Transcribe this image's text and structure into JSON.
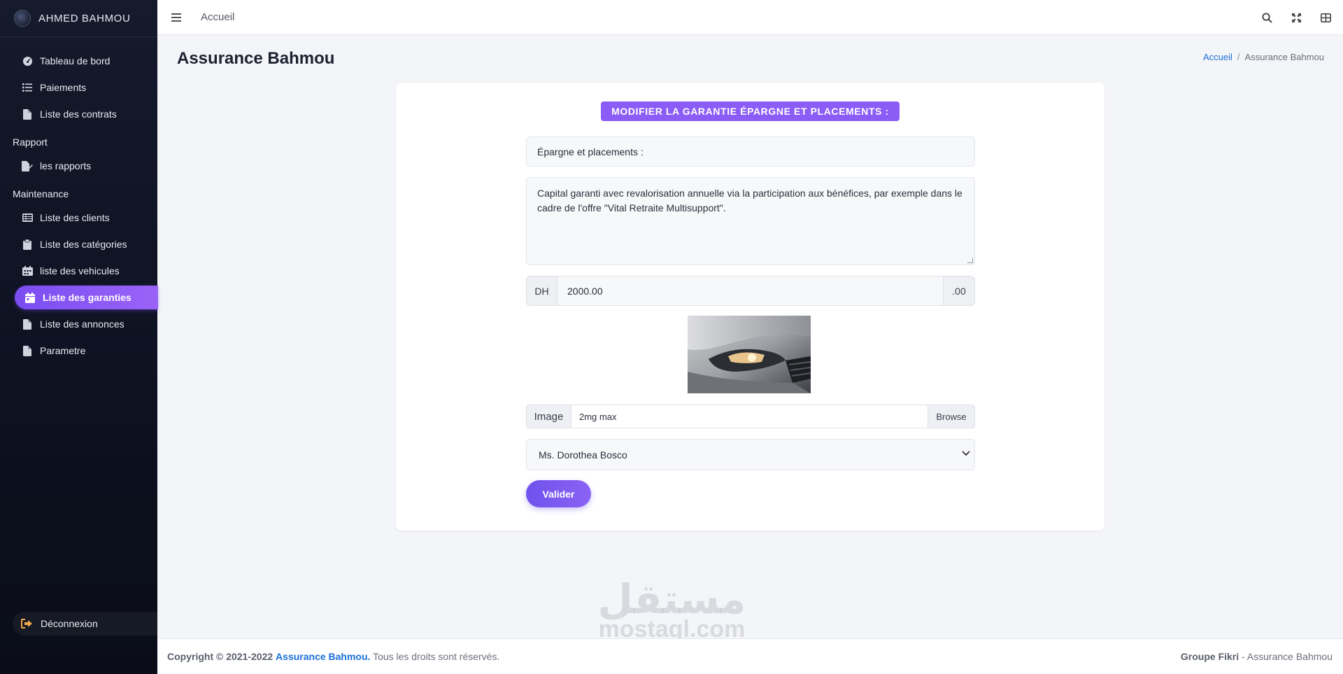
{
  "sidebar": {
    "brand": "AHMED BAHMOU",
    "items": [
      {
        "label": "Tableau de bord"
      },
      {
        "label": "Paiements"
      },
      {
        "label": "Liste des contrats"
      }
    ],
    "section_rapport": "Rapport",
    "rapport_items": [
      {
        "label": "les rapports"
      }
    ],
    "section_maintenance": "Maintenance",
    "maintenance_items": [
      {
        "label": "Liste des clients"
      },
      {
        "label": "Liste des catégories"
      },
      {
        "label": "liste des vehicules"
      },
      {
        "label": "Liste des garanties",
        "active": true
      },
      {
        "label": "Liste des annonces"
      },
      {
        "label": "Parametre"
      }
    ],
    "logout": "Déconnexion"
  },
  "topbar": {
    "home_link": "Accueil"
  },
  "page": {
    "title": "Assurance Bahmou",
    "breadcrumb": {
      "home": "Accueil",
      "separator": "/",
      "current": "Assurance Bahmou"
    }
  },
  "form": {
    "heading": "MODIFIER LA GARANTIE ÉPARGNE ET PLACEMENTS :",
    "name_value": "Épargne et placements :",
    "description_value": "Capital garanti avec revalorisation annuelle via la participation aux bénéfices, par exemple dans le cadre de l'offre \"Vital Retraite Multisupport\".",
    "price_prefix": "DH",
    "price_value": "2000.00",
    "price_suffix": ".00",
    "image_label": "Image",
    "image_placeholder": "2mg max",
    "browse_label": "Browse",
    "select_value": "Ms. Dorothea Bosco",
    "submit_label": "Valider"
  },
  "watermark": {
    "arabic": "مستقل",
    "latin": "mostaql.com"
  },
  "footer": {
    "copyright_prefix": "Copyright © 2021-2022",
    "copyright_brand": "Assurance Bahmou.",
    "copyright_suffix": "Tous les droits sont réservés.",
    "right_bold": "Groupe Fikri",
    "right_text": "- Assurance Bahmou"
  },
  "colors": {
    "sidebar_bg": "#0d1120",
    "accent": "#8b5cf6",
    "link": "#1a6fd8"
  }
}
